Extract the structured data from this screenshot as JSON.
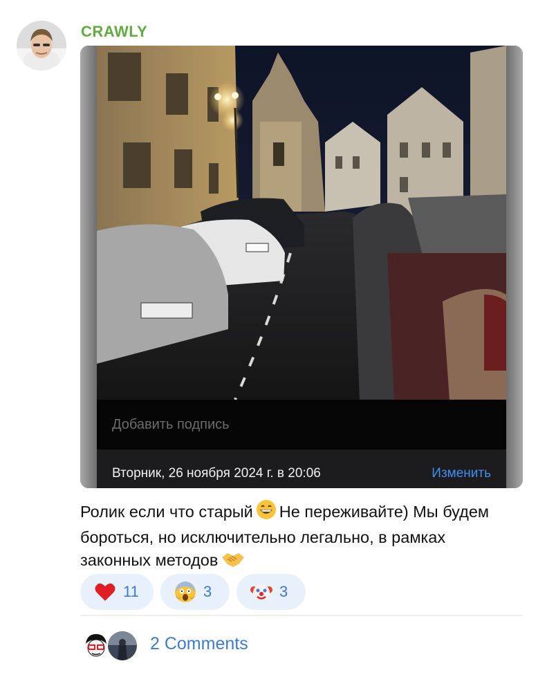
{
  "post": {
    "author": "CRAWLY",
    "avatar_icon": "user-avatar-photo",
    "media": {
      "caption_placeholder": "Добавить подпись",
      "date_text": "Вторник, 26 ноября 2024 г. в 20:06",
      "edit_label": "Изменить"
    },
    "message": {
      "part1": "Ролик если что старый",
      "part2": "Не переживайте) Мы будем бороться, но исключительно легально, в рамках законных методов",
      "emoji1": "grinning-face-emoji",
      "emoji2": "handshake-emoji"
    },
    "reactions": [
      {
        "emoji": "red-heart-emoji",
        "count": "11"
      },
      {
        "emoji": "screaming-face-emoji",
        "count": "3"
      },
      {
        "emoji": "clown-face-emoji",
        "count": "3"
      }
    ],
    "comments": {
      "label": "2 Comments",
      "avatars": [
        "commenter-avatar-1",
        "commenter-avatar-2"
      ]
    }
  },
  "colors": {
    "author": "#5fae3c",
    "link": "#3a7bd5",
    "reaction_bg": "#e8f0fb",
    "edit_link": "#3d8ff0"
  }
}
